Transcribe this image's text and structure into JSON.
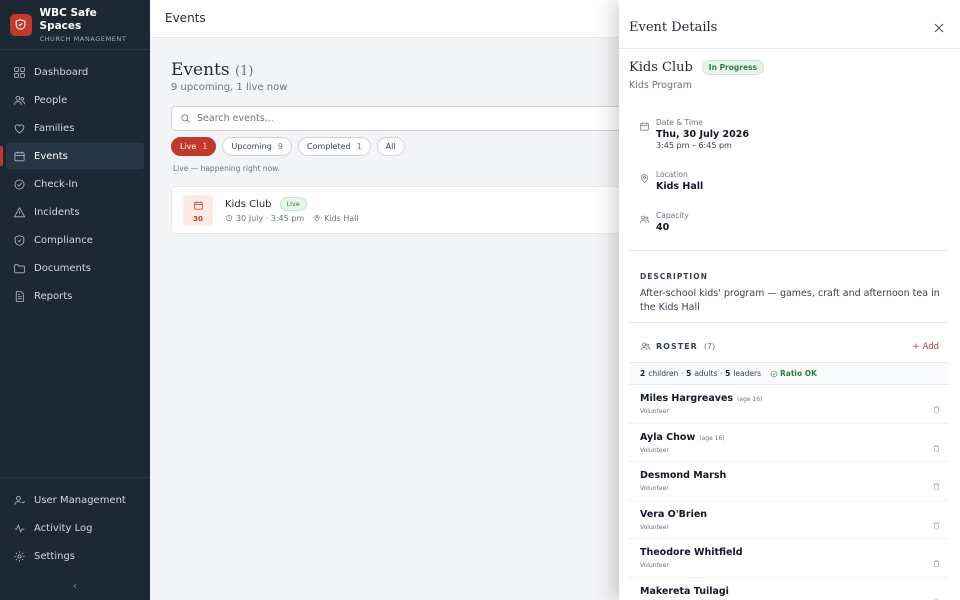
{
  "brand": {
    "name": "WBC Safe Spaces",
    "subtitle": "CHURCH MANAGEMENT"
  },
  "sidebar": {
    "items": [
      {
        "label": "Dashboard",
        "icon": "grid-icon"
      },
      {
        "label": "People",
        "icon": "people-icon"
      },
      {
        "label": "Families",
        "icon": "heart-icon"
      },
      {
        "label": "Events",
        "icon": "calendar-icon",
        "active": true
      },
      {
        "label": "Check-In",
        "icon": "check-in-icon"
      },
      {
        "label": "Incidents",
        "icon": "warning-icon"
      },
      {
        "label": "Compliance",
        "icon": "shield-icon"
      },
      {
        "label": "Documents",
        "icon": "folder-icon"
      },
      {
        "label": "Reports",
        "icon": "report-icon"
      }
    ],
    "bottom_items": [
      {
        "label": "User Management",
        "icon": "user-management-icon"
      },
      {
        "label": "Activity Log",
        "icon": "activity-icon"
      },
      {
        "label": "Settings",
        "icon": "gear-icon"
      }
    ],
    "collapse_glyph": "‹"
  },
  "header": {
    "title": "Events"
  },
  "main": {
    "heading": "Events",
    "heading_count": "(1)",
    "subtitle": "9 upcoming, 1 live now",
    "search_placeholder": "Search events...",
    "filters": [
      {
        "label": "Live",
        "count": "1",
        "active": true
      },
      {
        "label": "Upcoming",
        "count": "9"
      },
      {
        "label": "Completed",
        "count": "1"
      },
      {
        "label": "All",
        "count": ""
      }
    ],
    "live_note": "Live — happening right now.",
    "events": [
      {
        "day": "30",
        "title": "Kids Club",
        "status": "Live",
        "date_time": "30 July · 3:45 pm",
        "location": "Kids Hall"
      }
    ]
  },
  "panel": {
    "title": "Event Details",
    "event_name": "Kids Club",
    "status_badge": "In Progress",
    "event_type": "Kids Program",
    "date_label": "Date & Time",
    "date_value": "Thu, 30 July 2026",
    "time_value": "3:45 pm – 6:45 pm",
    "location_label": "Location",
    "location_value": "Kids Hall",
    "capacity_label": "Capacity",
    "capacity_value": "40",
    "description_label": "DESCRIPTION",
    "description": "After-school kids' program — games, craft and afternoon tea in the Kids Hall",
    "roster_label": "ROSTER",
    "roster_count": "(7)",
    "add_label": "Add",
    "ratio": {
      "children_n": "2",
      "children_label": "children ·",
      "adults_n": "5",
      "adults_label": "adults ·",
      "leaders_n": "5",
      "leaders_label": "leaders",
      "status": "Ratio OK"
    },
    "roster": [
      {
        "name": "Miles Hargreaves",
        "age": "(age 16)",
        "role": "Volunteer"
      },
      {
        "name": "Ayla Chow",
        "age": "(age 16)",
        "role": "Volunteer"
      },
      {
        "name": "Desmond Marsh",
        "age": "",
        "role": "Volunteer"
      },
      {
        "name": "Vera O'Brien",
        "age": "",
        "role": "Volunteer"
      },
      {
        "name": "Theodore Whitfield",
        "age": "",
        "role": "Volunteer"
      },
      {
        "name": "Makereta Tuilagi",
        "age": "",
        "role": ""
      }
    ]
  },
  "colors": {
    "accent": "#c0392b",
    "sidebar_bg": "#1c2833",
    "success": "#2e7d42"
  }
}
